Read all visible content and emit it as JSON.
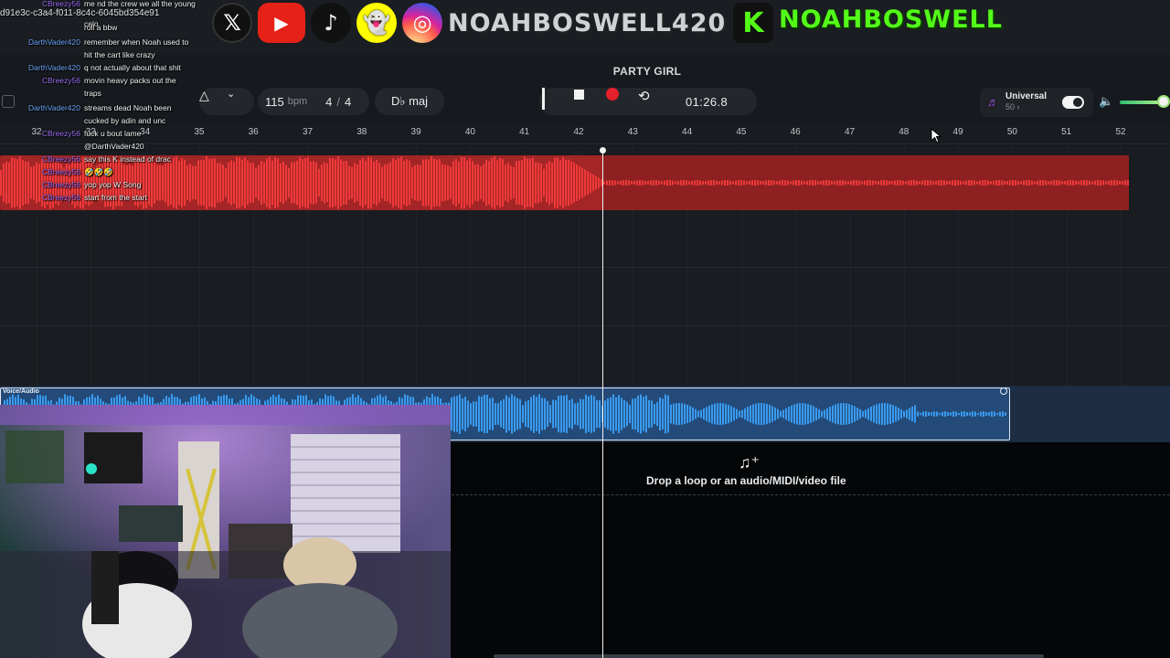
{
  "overlay": {
    "socials": [
      {
        "icon": "x-logo-icon",
        "glyph": "𝕏"
      },
      {
        "icon": "youtube-icon",
        "glyph": "▶"
      },
      {
        "icon": "tiktok-icon",
        "glyph": "♪"
      },
      {
        "icon": "snapchat-icon",
        "glyph": "👻"
      },
      {
        "icon": "instagram-icon",
        "glyph": "◎"
      }
    ],
    "handle": "NOAHBOSWELL420",
    "kick_letter": "K",
    "kick_handle": "NOAHBOSWELL",
    "guid_text": "d91e3c-c3a4-f011-8c4c-6045bd354e91"
  },
  "chat": [
    {
      "user": "CBreezy56",
      "color": "purple",
      "text": "me nd the crew we all the young"
    },
    {
      "user": "",
      "color": "purple",
      "text": "celo"
    },
    {
      "user": "",
      "color": "red",
      "text": "roll a bbw"
    },
    {
      "user": "DarthVader420",
      "color": "blue",
      "text": "remember when Noah used to"
    },
    {
      "user": "",
      "color": "blue",
      "text": "hit the cart like crazy"
    },
    {
      "user": "DarthVader420",
      "color": "blue",
      "text": "q not actually about that shit"
    },
    {
      "user": "CBreezy56",
      "color": "purple",
      "text": "movin heavy packs out the"
    },
    {
      "user": "",
      "color": "purple",
      "text": "traps"
    },
    {
      "user": "DarthVader420",
      "color": "blue",
      "text": "streams dead Noah been"
    },
    {
      "user": "",
      "color": "blue",
      "text": "cucked by adin and unc"
    },
    {
      "user": "CBreezy56",
      "color": "purple",
      "text": "fuck u bout lame"
    },
    {
      "user": "",
      "color": "purple",
      "text": "@DarthVader420"
    },
    {
      "user": "CBreezy56",
      "color": "purple",
      "text": "say this K instead of drac"
    },
    {
      "user": "CBreezy56",
      "color": "purple",
      "text": "🤣🤣🤣"
    },
    {
      "user": "CBreezy56",
      "color": "purple",
      "text": "yop yop W Song"
    },
    {
      "user": "CBreezy56",
      "color": "purple",
      "text": "start from the start"
    }
  ],
  "song": {
    "title": "PARTY GIRL"
  },
  "transport": {
    "metronome_icon": "metronome-icon",
    "bpm": "115",
    "bpm_unit": "bpm",
    "time_sig_num": "4",
    "time_sig_den": "4",
    "key": "D♭ maj",
    "time": "01:26.8"
  },
  "universal": {
    "label": "Universal",
    "sub": "50 ›",
    "toggle_on": true
  },
  "volume": {
    "level": 0.85
  },
  "ruler": {
    "bars": [
      "32",
      "33",
      "34",
      "35",
      "36",
      "37",
      "38",
      "39",
      "40",
      "41",
      "42",
      "43",
      "44",
      "45",
      "46",
      "47",
      "48",
      "49",
      "50",
      "51",
      "52"
    ]
  },
  "tracks": {
    "voice_label": "Voice/Audio",
    "drop_text": "Drop a loop or an audio/MIDI/video file"
  },
  "colors": {
    "red_clip": "#e02a2a",
    "blue_clip": "#3aa0ff",
    "accent_green": "#53fc18"
  }
}
